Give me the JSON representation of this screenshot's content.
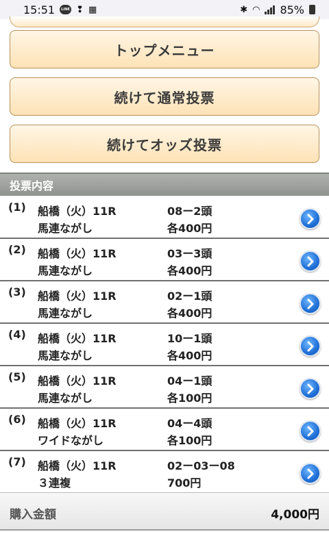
{
  "status": {
    "time": "15:51",
    "battery": "85%"
  },
  "nav": {
    "top_menu": "トップメニュー",
    "continue_normal": "続けて通常投票",
    "continue_odds": "続けてオッズ投票"
  },
  "section_title": "投票内容",
  "bets": [
    {
      "no": "(1)",
      "venue": "船橋（火）11R",
      "type": "馬連ながし",
      "combo": "08ー2頭",
      "amount": "各400円"
    },
    {
      "no": "(2)",
      "venue": "船橋（火）11R",
      "type": "馬連ながし",
      "combo": "03ー3頭",
      "amount": "各400円"
    },
    {
      "no": "(3)",
      "venue": "船橋（火）11R",
      "type": "馬連ながし",
      "combo": "02ー1頭",
      "amount": "各400円"
    },
    {
      "no": "(4)",
      "venue": "船橋（火）11R",
      "type": "馬連ながし",
      "combo": "10ー1頭",
      "amount": "各400円"
    },
    {
      "no": "(5)",
      "venue": "船橋（火）11R",
      "type": "馬連ながし",
      "combo": "04ー1頭",
      "amount": "各100円"
    },
    {
      "no": "(6)",
      "venue": "船橋（火）11R",
      "type": "ワイドながし",
      "combo": "04ー4頭",
      "amount": "各100円"
    },
    {
      "no": "(7)",
      "venue": "船橋（火）11R",
      "type": "３連複",
      "combo": "02ー03ー08",
      "amount": "700円"
    }
  ],
  "total": {
    "label": "購入金額",
    "value": "4,000円"
  }
}
